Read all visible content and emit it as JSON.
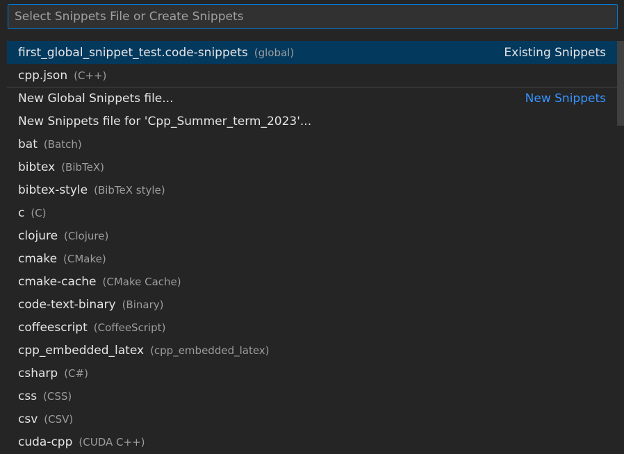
{
  "search": {
    "placeholder": "Select Snippets File or Create Snippets"
  },
  "groups": {
    "existing": "Existing Snippets",
    "new": "New Snippets"
  },
  "items": [
    {
      "label": "first_global_snippet_test.code-snippets",
      "desc": "(global)"
    },
    {
      "label": "cpp.json",
      "desc": "(C++)"
    },
    {
      "label": "New Global Snippets file...",
      "desc": ""
    },
    {
      "label": "New Snippets file for 'Cpp_Summer_term_2023'...",
      "desc": ""
    },
    {
      "label": "bat",
      "desc": "(Batch)"
    },
    {
      "label": "bibtex",
      "desc": "(BibTeX)"
    },
    {
      "label": "bibtex-style",
      "desc": "(BibTeX style)"
    },
    {
      "label": "c",
      "desc": "(C)"
    },
    {
      "label": "clojure",
      "desc": "(Clojure)"
    },
    {
      "label": "cmake",
      "desc": "(CMake)"
    },
    {
      "label": "cmake-cache",
      "desc": "(CMake Cache)"
    },
    {
      "label": "code-text-binary",
      "desc": "(Binary)"
    },
    {
      "label": "coffeescript",
      "desc": "(CoffeeScript)"
    },
    {
      "label": "cpp_embedded_latex",
      "desc": "(cpp_embedded_latex)"
    },
    {
      "label": "csharp",
      "desc": "(C#)"
    },
    {
      "label": "css",
      "desc": "(CSS)"
    },
    {
      "label": "csv",
      "desc": "(CSV)"
    },
    {
      "label": "cuda-cpp",
      "desc": "(CUDA C++)"
    }
  ],
  "colors": {
    "background": "#252526",
    "selected": "#04395e",
    "focus_border": "#0078d4",
    "link": "#3794ff"
  }
}
